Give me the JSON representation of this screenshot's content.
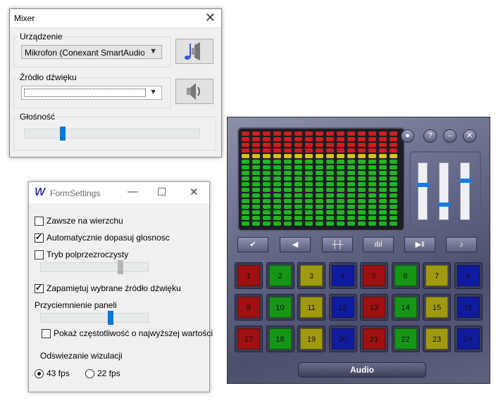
{
  "mixer": {
    "title": "Mixer",
    "device_label": "Urządzenie",
    "device_value": "Mikrofon (Conexant SmartAudio H",
    "source_label": "Źródło dźwięku",
    "source_value": "",
    "volume_label": "Głośność",
    "volume_level": 0.21
  },
  "settings": {
    "title": "FormSettings",
    "always_on_top": {
      "label": "Zawsze na wierzchu",
      "checked": false
    },
    "auto_adjust": {
      "label": "Automatycznie dopasuj glosnosc",
      "checked": true
    },
    "transparent_mode": {
      "label": "Tryb polprzezroczysty",
      "checked": false
    },
    "transparency_level": 0.75,
    "remember_source": {
      "label": "Zapamiętuj wybrane źródło dźwięku",
      "checked": true
    },
    "dim_label": "Przyciemnienie paneli",
    "dim_level": 0.66,
    "show_freq": {
      "label": "Pokaż częstotliwość o najwyższej wartości",
      "checked": false
    },
    "refresh_label": "Odswiezanie wizulacji",
    "fps_options": [
      {
        "label": "43 fps",
        "selected": true
      },
      {
        "label": "22 fps",
        "selected": false
      }
    ]
  },
  "skin": {
    "footer_label": "Audio",
    "channels": [
      "1",
      "2",
      "3",
      "4",
      "5",
      "6",
      "7",
      "8",
      "9",
      "10",
      "11",
      "12",
      "13",
      "14",
      "15",
      "16",
      "17",
      "18",
      "19",
      "20",
      "21",
      "22",
      "23",
      "24"
    ],
    "channel_colors": [
      "#a01010",
      "#159615",
      "#a09a10",
      "#101ca0"
    ],
    "vertical_levels": [
      0.62,
      0.25,
      0.7
    ],
    "accent": "#1a7be0"
  }
}
